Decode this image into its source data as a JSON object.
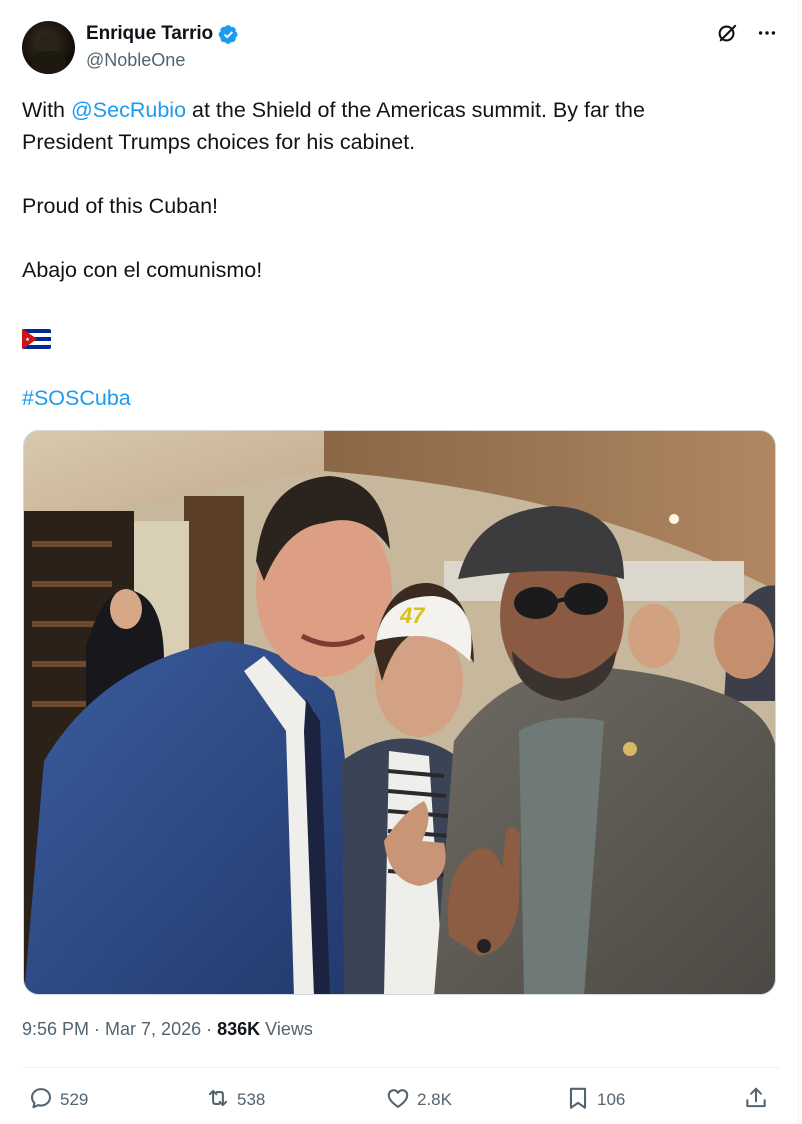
{
  "author": {
    "display_name": "Enrique Tarrio",
    "handle": "@NobleOne",
    "verified": true
  },
  "post": {
    "line1_prefix": "With ",
    "mention": "@SecRubio",
    "line1_suffix": " at the Shield of the Americas summit. By far the",
    "line2": "President Trumps choices for his cabinet.",
    "line3": "Proud of this Cuban!",
    "line4": "Abajo con el comunismo!",
    "flag": "cuba-flag-emoji",
    "hashtag": "#SOSCuba"
  },
  "meta": {
    "time": "9:56 PM",
    "separator": " · ",
    "date": "Mar 7, 2026",
    "views_count": "836K",
    "views_label": " Views"
  },
  "actions": {
    "replies": "529",
    "reposts": "538",
    "likes": "2.8K",
    "bookmarks": "106"
  },
  "icons": [
    "grok-icon",
    "more-icon",
    "reply-icon",
    "repost-icon",
    "like-icon",
    "bookmark-icon",
    "share-icon",
    "verified-badge-icon"
  ],
  "colors": {
    "accent": "#1d9bf0",
    "secondary_text": "#536471",
    "primary_text": "#0f1419"
  }
}
